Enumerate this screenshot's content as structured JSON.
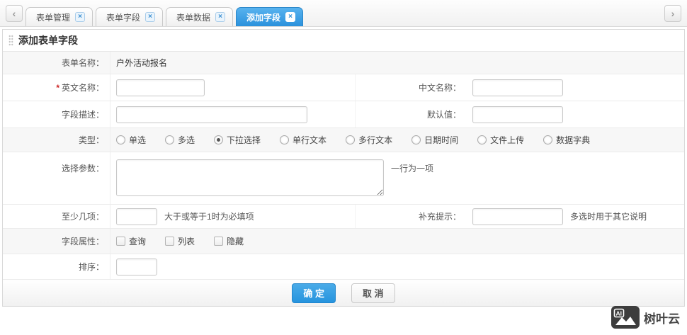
{
  "tabs": {
    "scroll_left_glyph": "‹",
    "scroll_right_glyph": "›",
    "close_glyph": "×",
    "items": [
      {
        "label": "表单管理",
        "active": false
      },
      {
        "label": "表单字段",
        "active": false
      },
      {
        "label": "表单数据",
        "active": false
      },
      {
        "label": "添加字段",
        "active": true
      }
    ]
  },
  "panel": {
    "title": "添加表单字段"
  },
  "form": {
    "form_name": {
      "label": "表单名称：",
      "value": "户外活动报名"
    },
    "english_name": {
      "required_mark": "*",
      "label": "英文名称：",
      "value": ""
    },
    "chinese_name": {
      "label": "中文名称：",
      "value": ""
    },
    "field_desc": {
      "label": "字段描述：",
      "value": ""
    },
    "default_value": {
      "label": "默认值：",
      "value": ""
    },
    "type": {
      "label": "类型：",
      "options": [
        "单选",
        "多选",
        "下拉选择",
        "单行文本",
        "多行文本",
        "日期时间",
        "文件上传",
        "数据字典"
      ],
      "selected": "下拉选择"
    },
    "choice_params": {
      "label": "选择参数：",
      "value": "",
      "hint": "一行为一项"
    },
    "min_items": {
      "label": "至少几项：",
      "value": "",
      "hint": "大于或等于1时为必填项"
    },
    "extra_tip": {
      "label": "补充提示：",
      "value": "",
      "hint": "多选时用于其它说明"
    },
    "field_attrs": {
      "label": "字段属性：",
      "options": [
        "查询",
        "列表",
        "隐藏"
      ],
      "checked": []
    },
    "sort": {
      "label": "排序：",
      "value": ""
    },
    "buttons": {
      "ok": "确 定",
      "cancel": "取 消"
    }
  },
  "watermark": {
    "icon_label": "AI",
    "text": "树叶云"
  },
  "colors": {
    "accent_blue": "#2e9fe5",
    "tab_active_blue": "#2f97de",
    "required_red": "#cc2222"
  }
}
